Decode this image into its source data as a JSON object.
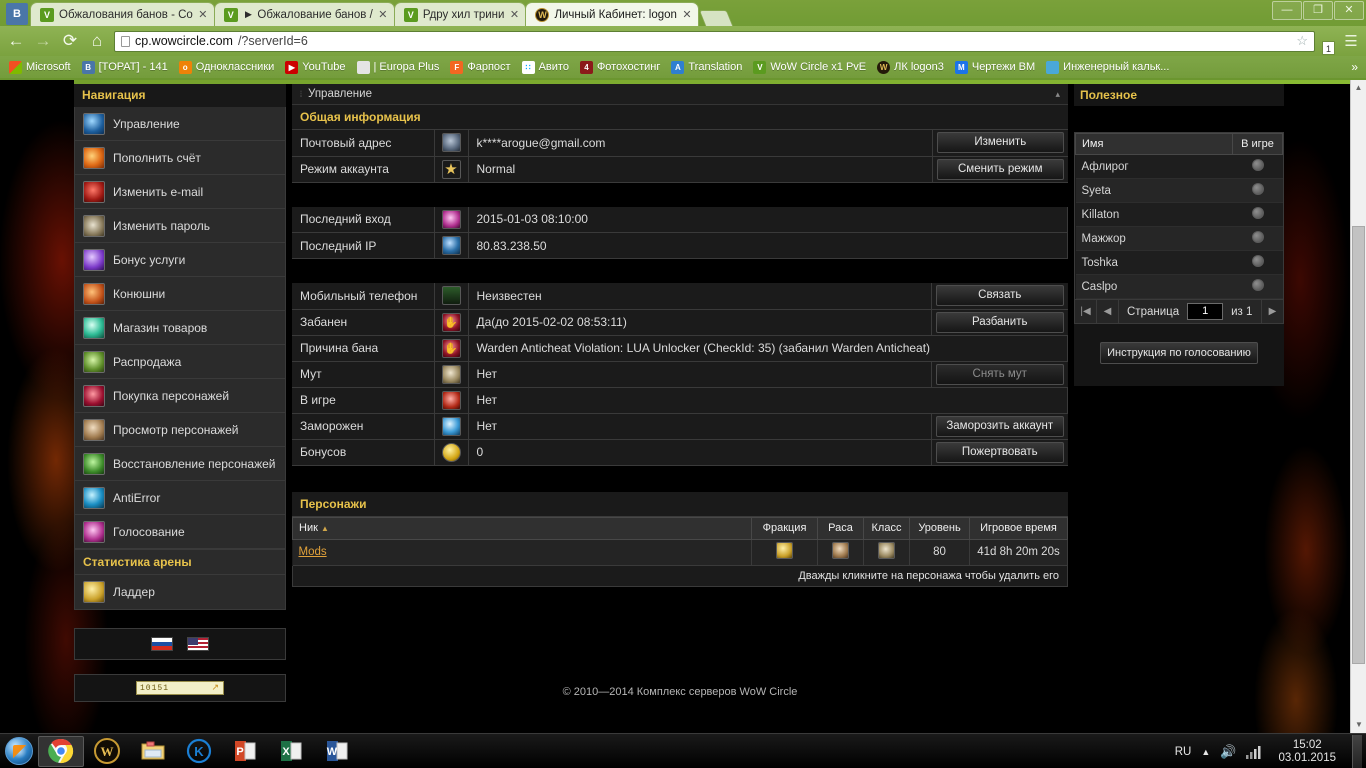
{
  "browser": {
    "tabs": [
      {
        "title": "Обжалования банов - Со",
        "favicon": "vk-icon",
        "active": false
      },
      {
        "title": "► Обжалование банов /",
        "favicon": "vk-icon",
        "active": false
      },
      {
        "title": "Рдру хил трини",
        "favicon": "vk-icon",
        "active": false
      },
      {
        "title": "Личный Кабинет: logon",
        "favicon": "wow-icon",
        "active": true
      }
    ],
    "tab_close_label": "✕",
    "window_controls": {
      "minimize": "—",
      "maximize": "❐",
      "close": "✕"
    },
    "nav": {
      "back": "←",
      "forward": "→",
      "reload": "⟳",
      "home": "⌂"
    },
    "address": {
      "host": "cp.wowcircle.com",
      "rest": "/?serverId=6",
      "star": "☆"
    },
    "download_badge": "1",
    "menu": "☰",
    "bookmarks": [
      {
        "label": "Microsoft",
        "icon": "microsoft-icon"
      },
      {
        "label": "[TOPAT] - 141",
        "icon": "vk-icon"
      },
      {
        "label": "Одноклассники",
        "icon": "ok-icon"
      },
      {
        "label": "YouTube",
        "icon": "youtube-icon"
      },
      {
        "label": "| Europa Plus",
        "icon": "radio-icon"
      },
      {
        "label": "Фарпост",
        "icon": "farpost-icon"
      },
      {
        "label": "Авито",
        "icon": "avito-icon"
      },
      {
        "label": "Фотохостинг",
        "icon": "photo-icon"
      },
      {
        "label": "Translation",
        "icon": "translate-icon"
      },
      {
        "label": "WoW Circle x1 PvE",
        "icon": "wowcircle-icon"
      },
      {
        "label": "ЛК logon3",
        "icon": "wow-icon"
      },
      {
        "label": "Чертежи ВМ",
        "icon": "m-icon"
      },
      {
        "label": "Инженерный кальк...",
        "icon": "calc-icon"
      }
    ],
    "bookmarks_overflow": "»"
  },
  "sidebar": {
    "title": "Навигация",
    "items": [
      {
        "label": "Управление",
        "icon": "management-icon",
        "art": "i-blue"
      },
      {
        "label": "Пополнить счёт",
        "icon": "topup-icon",
        "art": "i-fire"
      },
      {
        "label": "Изменить e-mail",
        "icon": "change-email-icon",
        "art": "i-red"
      },
      {
        "label": "Изменить пароль",
        "icon": "change-password-icon",
        "art": "i-eye"
      },
      {
        "label": "Бонус услуги",
        "icon": "bonus-services-icon",
        "art": "i-purp"
      },
      {
        "label": "Конюшни",
        "icon": "stables-icon",
        "art": "i-orng"
      },
      {
        "label": "Магазин товаров",
        "icon": "shop-icon",
        "art": "i-teal"
      },
      {
        "label": "Распродажа",
        "icon": "sale-icon",
        "art": "i-leaf"
      },
      {
        "label": "Покупка персонажей",
        "icon": "buy-character-icon",
        "art": "i-crim"
      },
      {
        "label": "Просмотр персонажей",
        "icon": "view-character-icon",
        "art": "i-face"
      },
      {
        "label": "Восстановление персонажей",
        "icon": "restore-character-icon",
        "art": "i-grn"
      },
      {
        "label": "AntiError",
        "icon": "antierror-icon",
        "art": "i-cyan"
      },
      {
        "label": "Голосование",
        "icon": "vote-icon",
        "art": "i-pnk"
      }
    ],
    "arena_title": "Статистика арены",
    "ladder": {
      "label": "Ладдер",
      "icon": "ladder-icon",
      "art": "i-gold"
    },
    "flags": [
      {
        "name": "flag-ru-icon"
      },
      {
        "name": "flag-us-icon"
      }
    ],
    "counter": {
      "value": "10151",
      "arrow": "↗"
    }
  },
  "main": {
    "panel_title": "Управление",
    "collapse_glyph": "▴",
    "grip_glyph": "⦙",
    "general": {
      "heading": "Общая информация",
      "rows": [
        {
          "label": "Почтовый адрес",
          "icon": "mail-icon",
          "art": "i-mail",
          "value": "k****arogue@gmail.com",
          "value_class": "val-white",
          "button": "Изменить"
        },
        {
          "label": "Режим аккаунта",
          "icon": "star-icon",
          "art": "i-star",
          "value": "Normal",
          "value_class": "val-white",
          "button": "Сменить режим"
        }
      ]
    },
    "login": {
      "rows": [
        {
          "label": "Последний вход",
          "icon": "login-icon",
          "art": "i-pnk",
          "value": "2015-01-03 08:10:00",
          "value_class": "val-orange",
          "button": ""
        },
        {
          "label": "Последний IP",
          "icon": "ip-icon",
          "art": "i-globe",
          "value": "80.83.238.50",
          "value_class": "val-orange",
          "button": ""
        }
      ]
    },
    "status": {
      "rows": [
        {
          "label": "Мобильный телефон",
          "icon": "phone-icon",
          "art": "i-phone",
          "value": "Неизвестен",
          "value_class": "val-orange",
          "button": "Связать"
        },
        {
          "label": "Забанен",
          "icon": "ban-icon",
          "art": "i-hand",
          "value": "Да(до 2015-02-02 08:53:11)",
          "value_class": "val-white",
          "button": "Разбанить"
        },
        {
          "label": "Причина бана",
          "icon": "ban-reason-icon",
          "art": "i-hand",
          "value": "Warden Anticheat Violation: LUA Unlocker (CheckId: 35) (забанил Warden Anticheat)",
          "value_class": "val-white",
          "button": ""
        },
        {
          "label": "Мут",
          "icon": "mute-icon",
          "art": "i-scroll",
          "value": "Нет",
          "value_class": "val-white",
          "button": "Снять мут",
          "button_disabled": true
        },
        {
          "label": "В игре",
          "icon": "ingame-icon",
          "art": "i-sword",
          "value": "Нет",
          "value_class": "val-white",
          "button": ""
        },
        {
          "label": "Заморожен",
          "icon": "frozen-icon",
          "art": "i-ice",
          "value": "Нет",
          "value_class": "val-white",
          "button": "Заморозить аккаунт"
        },
        {
          "label": "Бонусов",
          "icon": "bonus-icon",
          "art": "i-coin",
          "value": "0",
          "value_class": "val-orange",
          "button": "Пожертвовать"
        }
      ]
    },
    "characters": {
      "heading": "Персонажи",
      "columns": [
        "Ник",
        "Фракция",
        "Раса",
        "Класс",
        "Уровень",
        "Игровое время"
      ],
      "sort_glyph": "▲",
      "rows": [
        {
          "nick": "Mods",
          "faction_icon": "alliance-icon",
          "race_icon": "race-icon",
          "class_icon": "class-icon",
          "level": "80",
          "playtime": "41d 8h 20m 20s"
        }
      ],
      "hint": "Дважды кликните на персонажа чтобы удалить его"
    },
    "footer": "© 2010—2014 Комплекс серверов WoW Circle"
  },
  "rightpanel": {
    "title": "Полезное",
    "columns": {
      "name": "Имя",
      "ingame": "В игре"
    },
    "rows": [
      {
        "name": "Афлирог",
        "ingame_icon": "offline-icon"
      },
      {
        "name": "Syeta",
        "ingame_icon": "offline-icon"
      },
      {
        "name": "Killaton",
        "ingame_icon": "offline-icon"
      },
      {
        "name": "Мажжор",
        "ingame_icon": "offline-icon"
      },
      {
        "name": "Toshka",
        "ingame_icon": "offline-icon"
      },
      {
        "name": "Caslpo",
        "ingame_icon": "offline-icon"
      }
    ],
    "pager": {
      "first": "|◀",
      "prev": "◀",
      "label": "Страница",
      "value": "1",
      "of": "из 1",
      "next": "▶"
    },
    "vote_button": "Инструкция по голосованию"
  },
  "taskbar": {
    "start": "start-orb-icon",
    "items": [
      {
        "icon": "chrome-icon",
        "active": true
      },
      {
        "icon": "wow-icon",
        "active": false
      },
      {
        "icon": "explorer-icon",
        "active": false
      },
      {
        "icon": "kaspersky-icon",
        "active": false
      },
      {
        "icon": "powerpoint-icon",
        "active": false
      },
      {
        "icon": "excel-icon",
        "active": false
      },
      {
        "icon": "word-icon",
        "active": false
      }
    ],
    "language": "RU",
    "tray_up": "▲",
    "volume": "🔊",
    "network": "signal-icon",
    "time": "15:02",
    "date": "03.01.2015"
  },
  "scrollbar": {
    "up": "▲",
    "down": "▼"
  }
}
